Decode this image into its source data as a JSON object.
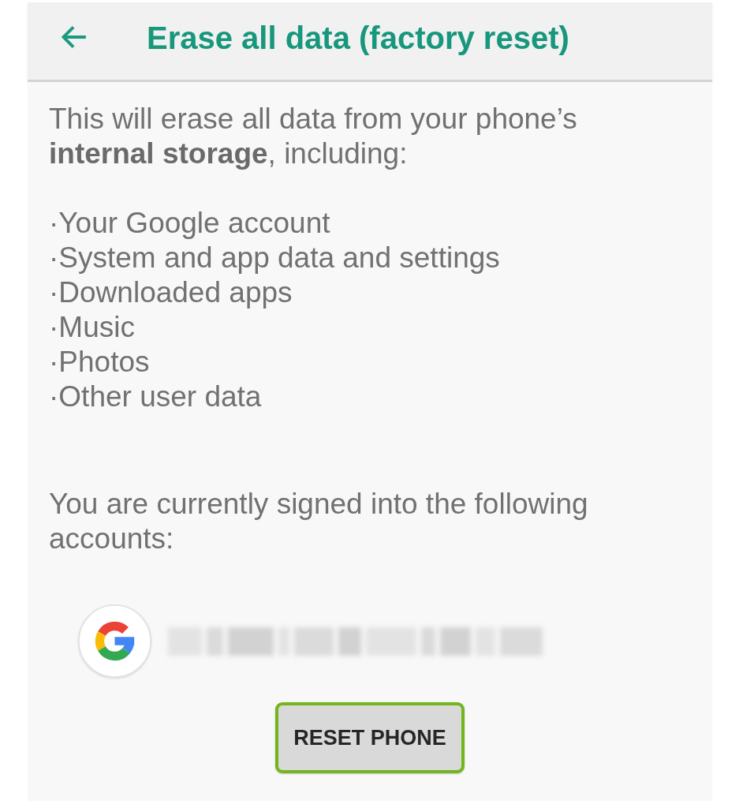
{
  "header": {
    "title": "Erase all data (factory reset)"
  },
  "intro": "This will erase all data from your phone’s **internal storage**, including:",
  "items": [
    "·Your Google account",
    "·System and app data and settings",
    "·Downloaded apps",
    "·Music",
    "·Photos",
    "·Other user data"
  ],
  "accounts_note": "You are currently signed into the following accounts:",
  "accounts": [
    {
      "kind": "google"
    }
  ],
  "button": {
    "label": "RESET PHONE",
    "highlighted": true
  }
}
